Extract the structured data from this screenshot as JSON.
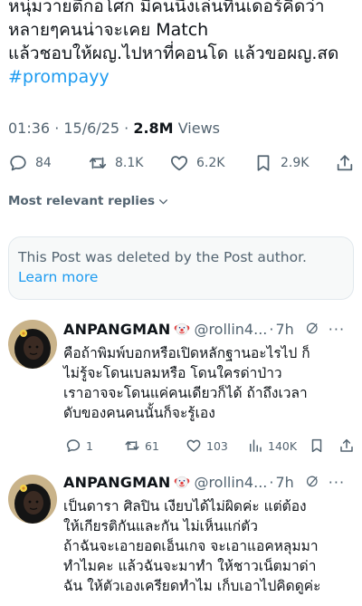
{
  "post": {
    "lines": [
      "หนุ่มวายตึกอโศก มีคนนึงเล่นทินเดอร์คิดว่า",
      "หลายๆคนน่าจะเคย Match",
      "แล้วชอบให้ผญ.ไปหาที่คอนโด แล้วขอผญ.สด"
    ],
    "hashtag": "#prompayy",
    "time": "01:36",
    "date": "15/6/25",
    "views_count": "2.8M",
    "views_label": "Views",
    "replies": "84",
    "reposts": "8.1K",
    "likes": "6.2K",
    "bookmarks": "2.9K"
  },
  "sort_label": "Most relevant replies",
  "deleted_notice": {
    "text": "This Post was deleted by the Post author.",
    "link": "Learn more"
  },
  "replies": [
    {
      "name": "ANPANGMAN",
      "handle": "@rollin4...",
      "time": "7h",
      "lines": [
        "คือถ้าพิมพ์บอกหรือเปิดหลักฐานอะไรไป ก็",
        "ไม่รู้จะโดนเบลมหรือ โดนใครด่าป่าว",
        "เราอาจจะโดนแค่คนเดียวก็ได้ ถ้าถึงเวลา",
        "ดับของคนคนนั้นก็จะรู้เอง"
      ],
      "stats": {
        "replies": "1",
        "reposts": "61",
        "likes": "103",
        "views": "140K"
      }
    },
    {
      "name": "ANPANGMAN",
      "handle": "@rollin4...",
      "time": "7h",
      "lines": [
        "เป็นดารา ศิลปิน เงียบได้ไม่ผิดค่ะ แต่ต้อง",
        "ให้เกียรติกันและกัน ไม่เห็นแก่ตัว",
        "ถ้าฉันจะเอายอดเอ็นเกจ จะเอาแอคหลุมมา",
        "ทำไมคะ แล้วฉันจะมาทำ ให้ชาวเน็ตมาด่า",
        "ฉัน ให้ตัวเองเครียดทำไม เก็บเอาไปคิดดูค่ะ"
      ]
    }
  ],
  "icons": {
    "reply": "speech-bubble-icon",
    "repost": "repost-arrows-icon",
    "like": "heart-icon",
    "bookmark": "bookmark-icon",
    "share": "share-upload-icon",
    "views": "bar-chart-icon",
    "grok": "grok-slash-circle-icon",
    "more": "ellipsis-icon",
    "emoji": "clown-face-emoji",
    "chevron": "chevron-down-icon"
  },
  "colors": {
    "text": "#0f1419",
    "muted": "#536471",
    "link": "#1d9bf0",
    "card_bg": "#f7f9f9",
    "border": "#e1e8ed"
  }
}
